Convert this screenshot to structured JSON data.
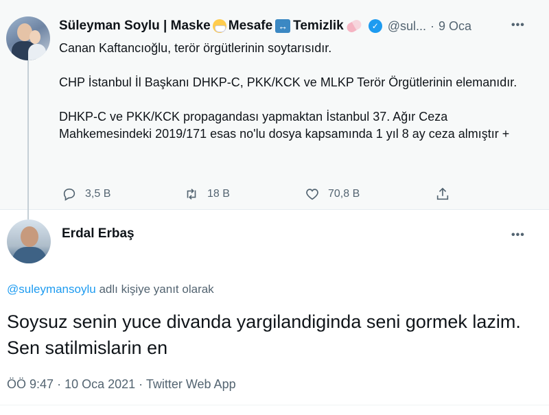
{
  "parent_tweet": {
    "author_name": "Süleyman Soylu | Maske",
    "name_part_2": "Mesafe",
    "name_part_3": "Temizlik",
    "handle": "@sul...",
    "separator": "·",
    "time": "9 Oca",
    "paragraphs": [
      "Canan Kaftancıoğlu, terör örgütlerinin soytarısıdır.",
      "CHP İstanbul İl Başkanı DHKP-C, PKK/KCK ve MLKP Terör Örgütlerinin elemanıdır.",
      "DHKP-C ve PKK/KCK propagandası yapmaktan İstanbul 37. Ağır Ceza Mahkemesindeki 2019/171 esas no'lu dosya kapsamında 1 yıl 8 ay ceza almıştır +"
    ],
    "stats": {
      "replies": "3,5 B",
      "retweets": "18 B",
      "likes": "70,8 B"
    },
    "icons": {
      "verified": "verified-badge-icon",
      "more": "more-icon"
    }
  },
  "reply_tweet": {
    "author_name": "Erdal Erbaş",
    "reply_to_mention": "@suleymansoylu",
    "reply_to_suffix": "adlı kişiye yanıt olarak",
    "text": "Soysuz senin yuce divanda yargilandiginda seni gormek lazim. Sen satilmislarin en",
    "meta": {
      "time": "ÖÖ 9:47",
      "date": "10 Oca 2021",
      "separator": "·",
      "source": "Twitter Web App"
    }
  },
  "colors": {
    "accent": "#1d9bf0",
    "secondary_text": "#536471",
    "parent_background": "#f7f9f9",
    "thread_line": "#c4cfd6"
  }
}
